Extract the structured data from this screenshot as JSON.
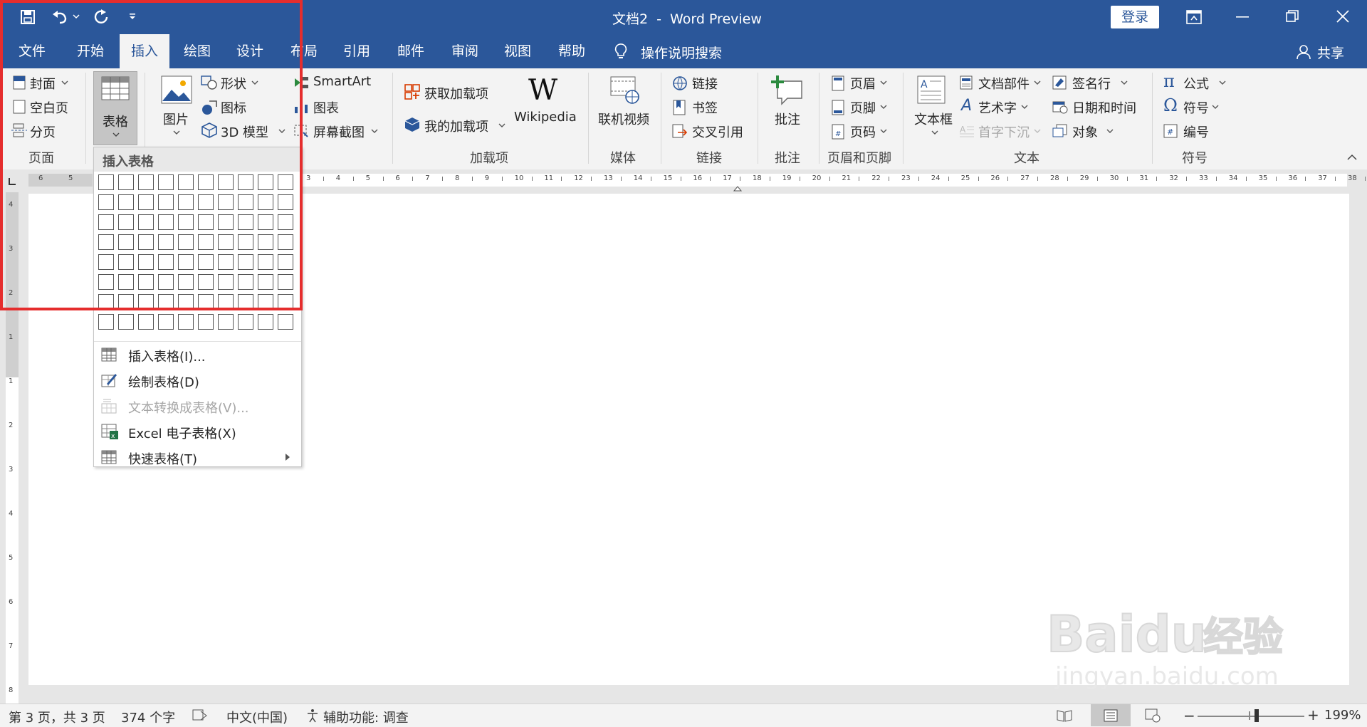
{
  "quick_access": {
    "save_icon": "save-icon",
    "undo_icon": "undo-icon",
    "redo_icon": "redo-icon",
    "customize_icon": "customize-qat-icon"
  },
  "title": {
    "doc_name": "文档2",
    "separator": "-",
    "app_name": "Word Preview"
  },
  "window": {
    "login_label": "登录",
    "ribbon_display_icon": "ribbon-display-icon",
    "minimize_icon": "minimize-icon",
    "restore_icon": "restore-icon",
    "close_icon": "close-icon"
  },
  "tabs": [
    {
      "label": "文件"
    },
    {
      "label": "开始"
    },
    {
      "label": "插入",
      "active": true
    },
    {
      "label": "绘图"
    },
    {
      "label": "设计"
    },
    {
      "label": "布局"
    },
    {
      "label": "引用"
    },
    {
      "label": "邮件"
    },
    {
      "label": "审阅"
    },
    {
      "label": "视图"
    },
    {
      "label": "帮助"
    }
  ],
  "tell_me": {
    "label": "操作说明搜索",
    "icon": "lightbulb-icon"
  },
  "share": {
    "label": "共享",
    "icon": "person-icon"
  },
  "ribbon": {
    "pages": {
      "cover": "封面",
      "blank": "空白页",
      "break": "分页",
      "group": "页面"
    },
    "table": {
      "label": "表格"
    },
    "illustrations": {
      "picture": "图片",
      "shapes": "形状",
      "icons": "图标",
      "model3d": "3D 模型",
      "smartart": "SmartArt",
      "chart": "图表",
      "screenshot": "屏幕截图"
    },
    "addins": {
      "get": "获取加载项",
      "my": "我的加载项",
      "wikipedia": "Wikipedia",
      "group": "加载项"
    },
    "media": {
      "online_video": "联机视频",
      "group": "媒体"
    },
    "links": {
      "link": "链接",
      "bookmark": "书签",
      "crossref": "交叉引用",
      "group": "链接"
    },
    "comments": {
      "comment": "批注",
      "group": "批注"
    },
    "header_footer": {
      "header": "页眉",
      "footer": "页脚",
      "page_number": "页码",
      "group": "页眉和页脚"
    },
    "text": {
      "textbox": "文本框",
      "quickparts": "文档部件",
      "wordart": "艺术字",
      "dropcap": "首字下沉",
      "signature": "签名行",
      "datetime": "日期和时间",
      "object": "对象",
      "group": "文本"
    },
    "symbols": {
      "equation": "公式",
      "symbol": "符号",
      "number": "编号",
      "group": "符号"
    }
  },
  "table_menu": {
    "header": "插入表格",
    "grid_cols": 10,
    "grid_rows": 8,
    "items": [
      {
        "label": "插入表格(I)...",
        "icon": "insert-table-icon",
        "disabled": false
      },
      {
        "label": "绘制表格(D)",
        "icon": "draw-table-icon",
        "disabled": false
      },
      {
        "label": "文本转换成表格(V)...",
        "icon": "convert-text-icon",
        "disabled": true
      },
      {
        "label": "Excel 电子表格(X)",
        "icon": "excel-icon",
        "disabled": false
      },
      {
        "label": "快速表格(T)",
        "icon": "quick-table-icon",
        "disabled": false,
        "submenu": true
      }
    ]
  },
  "ruler": {
    "left_numbers": [
      "6",
      "5"
    ],
    "numbers": [
      "3",
      "4",
      "5",
      "6",
      "7",
      "8",
      "9",
      "10",
      "11",
      "12",
      "13",
      "14",
      "15",
      "16",
      "17",
      "18",
      "19",
      "20",
      "21",
      "22",
      "23",
      "24",
      "25",
      "26",
      "27",
      "28",
      "29",
      "30",
      "31",
      "32",
      "33",
      "34",
      "35",
      "36",
      "37",
      "38"
    ],
    "vertical_numbers": [
      "4",
      "3",
      "2",
      "1",
      "1",
      "2",
      "3",
      "4",
      "5",
      "6",
      "7",
      "8"
    ]
  },
  "status": {
    "page": "第 3 页，共 3 页",
    "words": "374 个字",
    "language": "中文(中国)",
    "accessibility": "辅助功能: 调查",
    "zoom": "199%"
  },
  "watermark": {
    "brand": "Baidu",
    "brand_cn": "经验",
    "url": "jingyan.baidu.com"
  },
  "colors": {
    "title_bar": "#2b579a",
    "ribbon": "#f3f3f3",
    "highlight": "#e52d2d"
  }
}
